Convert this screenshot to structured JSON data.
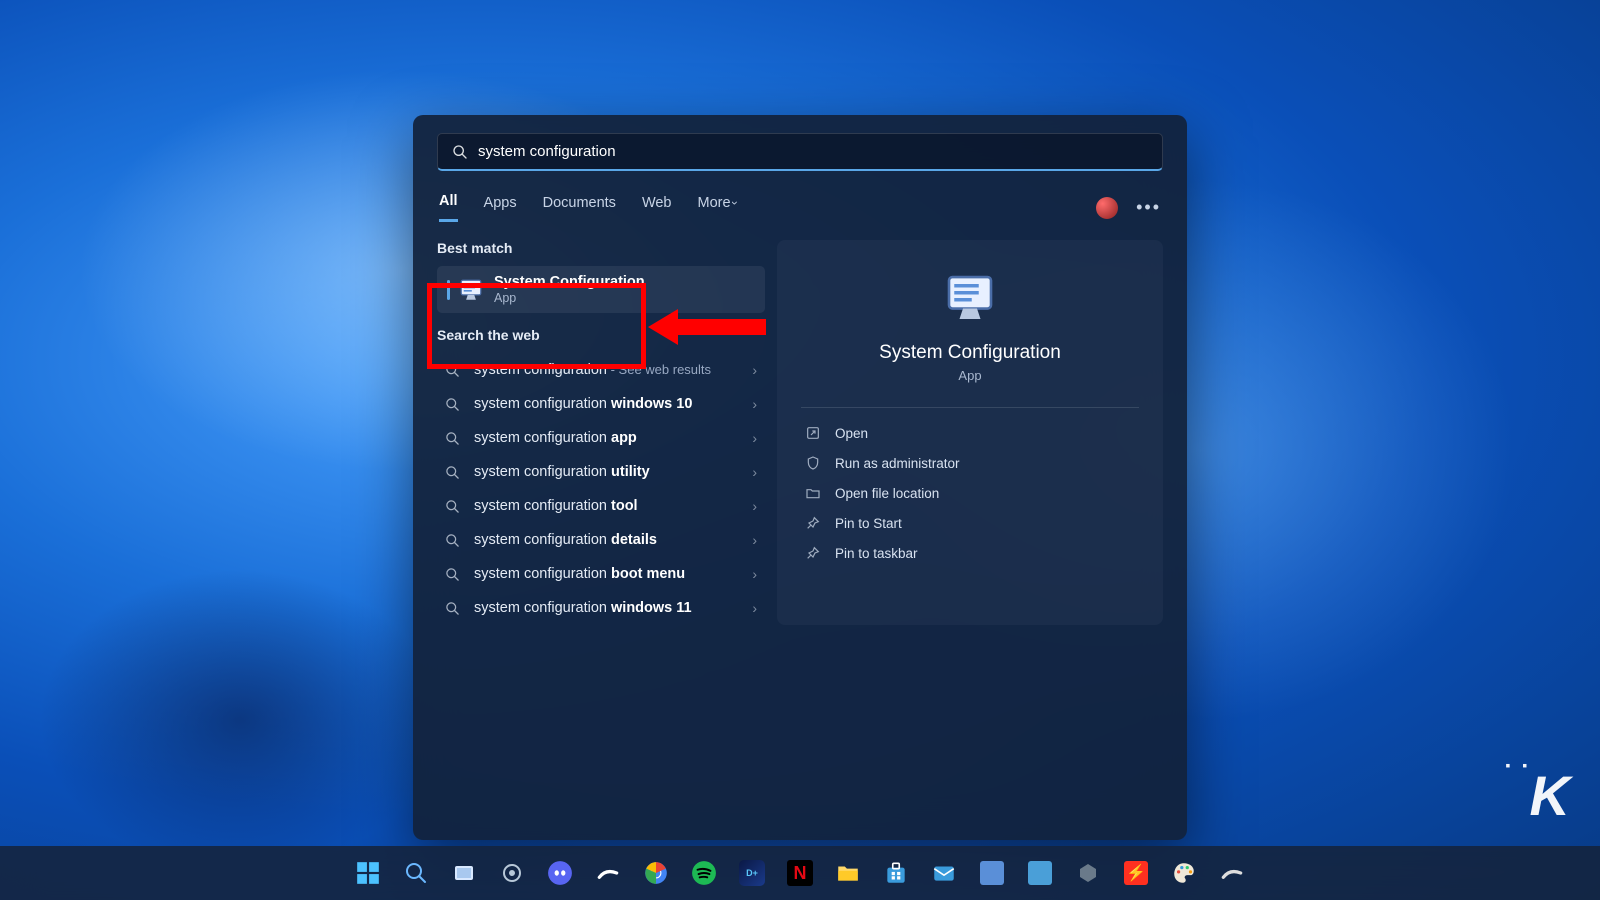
{
  "search": {
    "query": "system configuration"
  },
  "tabs": [
    "All",
    "Apps",
    "Documents",
    "Web",
    "More"
  ],
  "sections": {
    "best_match": "Best match",
    "search_web": "Search the web"
  },
  "best_match": {
    "title": "System Configuration",
    "subtitle": "App"
  },
  "web_results": [
    {
      "base": "system configuration",
      "suffix_sub": " - See web results"
    },
    {
      "base": "system configuration ",
      "suffix_bold": "windows 10"
    },
    {
      "base": "system configuration ",
      "suffix_bold": "app"
    },
    {
      "base": "system configuration ",
      "suffix_bold": "utility"
    },
    {
      "base": "system configuration ",
      "suffix_bold": "tool"
    },
    {
      "base": "system configuration ",
      "suffix_bold": "details"
    },
    {
      "base": "system configuration ",
      "suffix_bold": "boot menu"
    },
    {
      "base": "system configuration ",
      "suffix_bold": "windows 11"
    }
  ],
  "preview": {
    "title": "System Configuration",
    "subtitle": "App"
  },
  "actions": [
    {
      "icon": "open",
      "label": "Open"
    },
    {
      "icon": "shield",
      "label": "Run as administrator"
    },
    {
      "icon": "folder",
      "label": "Open file location"
    },
    {
      "icon": "pin",
      "label": "Pin to Start"
    },
    {
      "icon": "pin",
      "label": "Pin to taskbar"
    }
  ],
  "taskbar": [
    "start",
    "search",
    "taskview",
    "settings",
    "discord",
    "steam",
    "chrome",
    "spotify",
    "disney",
    "netflix",
    "explorer",
    "store",
    "mail",
    "monitor",
    "desktop",
    "unity",
    "bolt",
    "paint",
    "steam2"
  ],
  "watermark": "K"
}
